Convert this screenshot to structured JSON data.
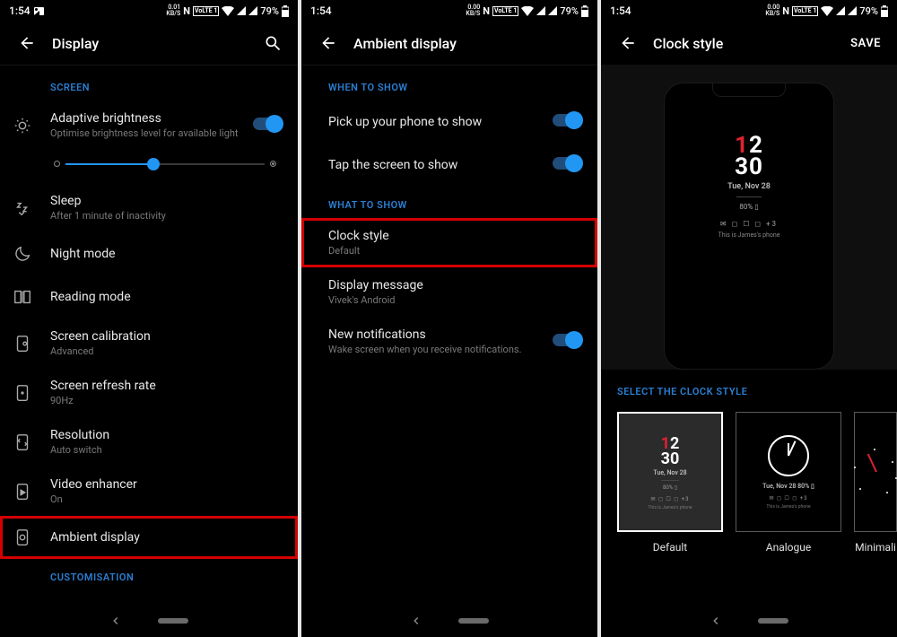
{
  "statusbar": {
    "time": "1:54",
    "rate_top1": "0.01",
    "rate_top2": "0.00",
    "rate_top3": "0.00",
    "rate_bot": "KB/S",
    "nfc": "N",
    "volte": "VoLTE 1",
    "battery_pct": "79%"
  },
  "panel1": {
    "title": "Display",
    "section_screen": "SCREEN",
    "adaptive": {
      "title": "Adaptive brightness",
      "sub": "Optimise brightness level for available light"
    },
    "sleep": {
      "title": "Sleep",
      "sub": "After 1 minute of inactivity"
    },
    "night": {
      "title": "Night mode"
    },
    "reading": {
      "title": "Reading mode"
    },
    "calibration": {
      "title": "Screen calibration",
      "sub": "Advanced"
    },
    "refresh": {
      "title": "Screen refresh rate",
      "sub": "90Hz"
    },
    "resolution": {
      "title": "Resolution",
      "sub": "Auto switch"
    },
    "video": {
      "title": "Video enhancer",
      "sub": "On"
    },
    "ambient": {
      "title": "Ambient display"
    },
    "section_custom": "CUSTOMISATION"
  },
  "panel2": {
    "title": "Ambient display",
    "section_when": "WHEN TO SHOW",
    "pickup": {
      "title": "Pick up your phone to show"
    },
    "tap": {
      "title": "Tap the screen to show"
    },
    "section_what": "WHAT TO SHOW",
    "clock": {
      "title": "Clock style",
      "sub": "Default"
    },
    "message": {
      "title": "Display message",
      "sub": "Vivek's Android"
    },
    "notif": {
      "title": "New notifications",
      "sub": "Wake screen when you receive notifications."
    }
  },
  "panel3": {
    "title": "Clock style",
    "save": "SAVE",
    "preview": {
      "hour": "12",
      "min": "30",
      "date": "Tue, Nov 28",
      "battery": "80% ▯",
      "icons": "✉ ◻ ☐ ◻  +3",
      "msg": "This is James's phone"
    },
    "section_select": "SELECT THE CLOCK STYLE",
    "styles": {
      "default": "Default",
      "analogue": "Analogue",
      "minimalistic": "Minimali"
    },
    "tile_sub": "80% ▯",
    "tile_date2": "Tue, Nov 28   80% ▯",
    "tile_msg": "This is James's phone"
  }
}
